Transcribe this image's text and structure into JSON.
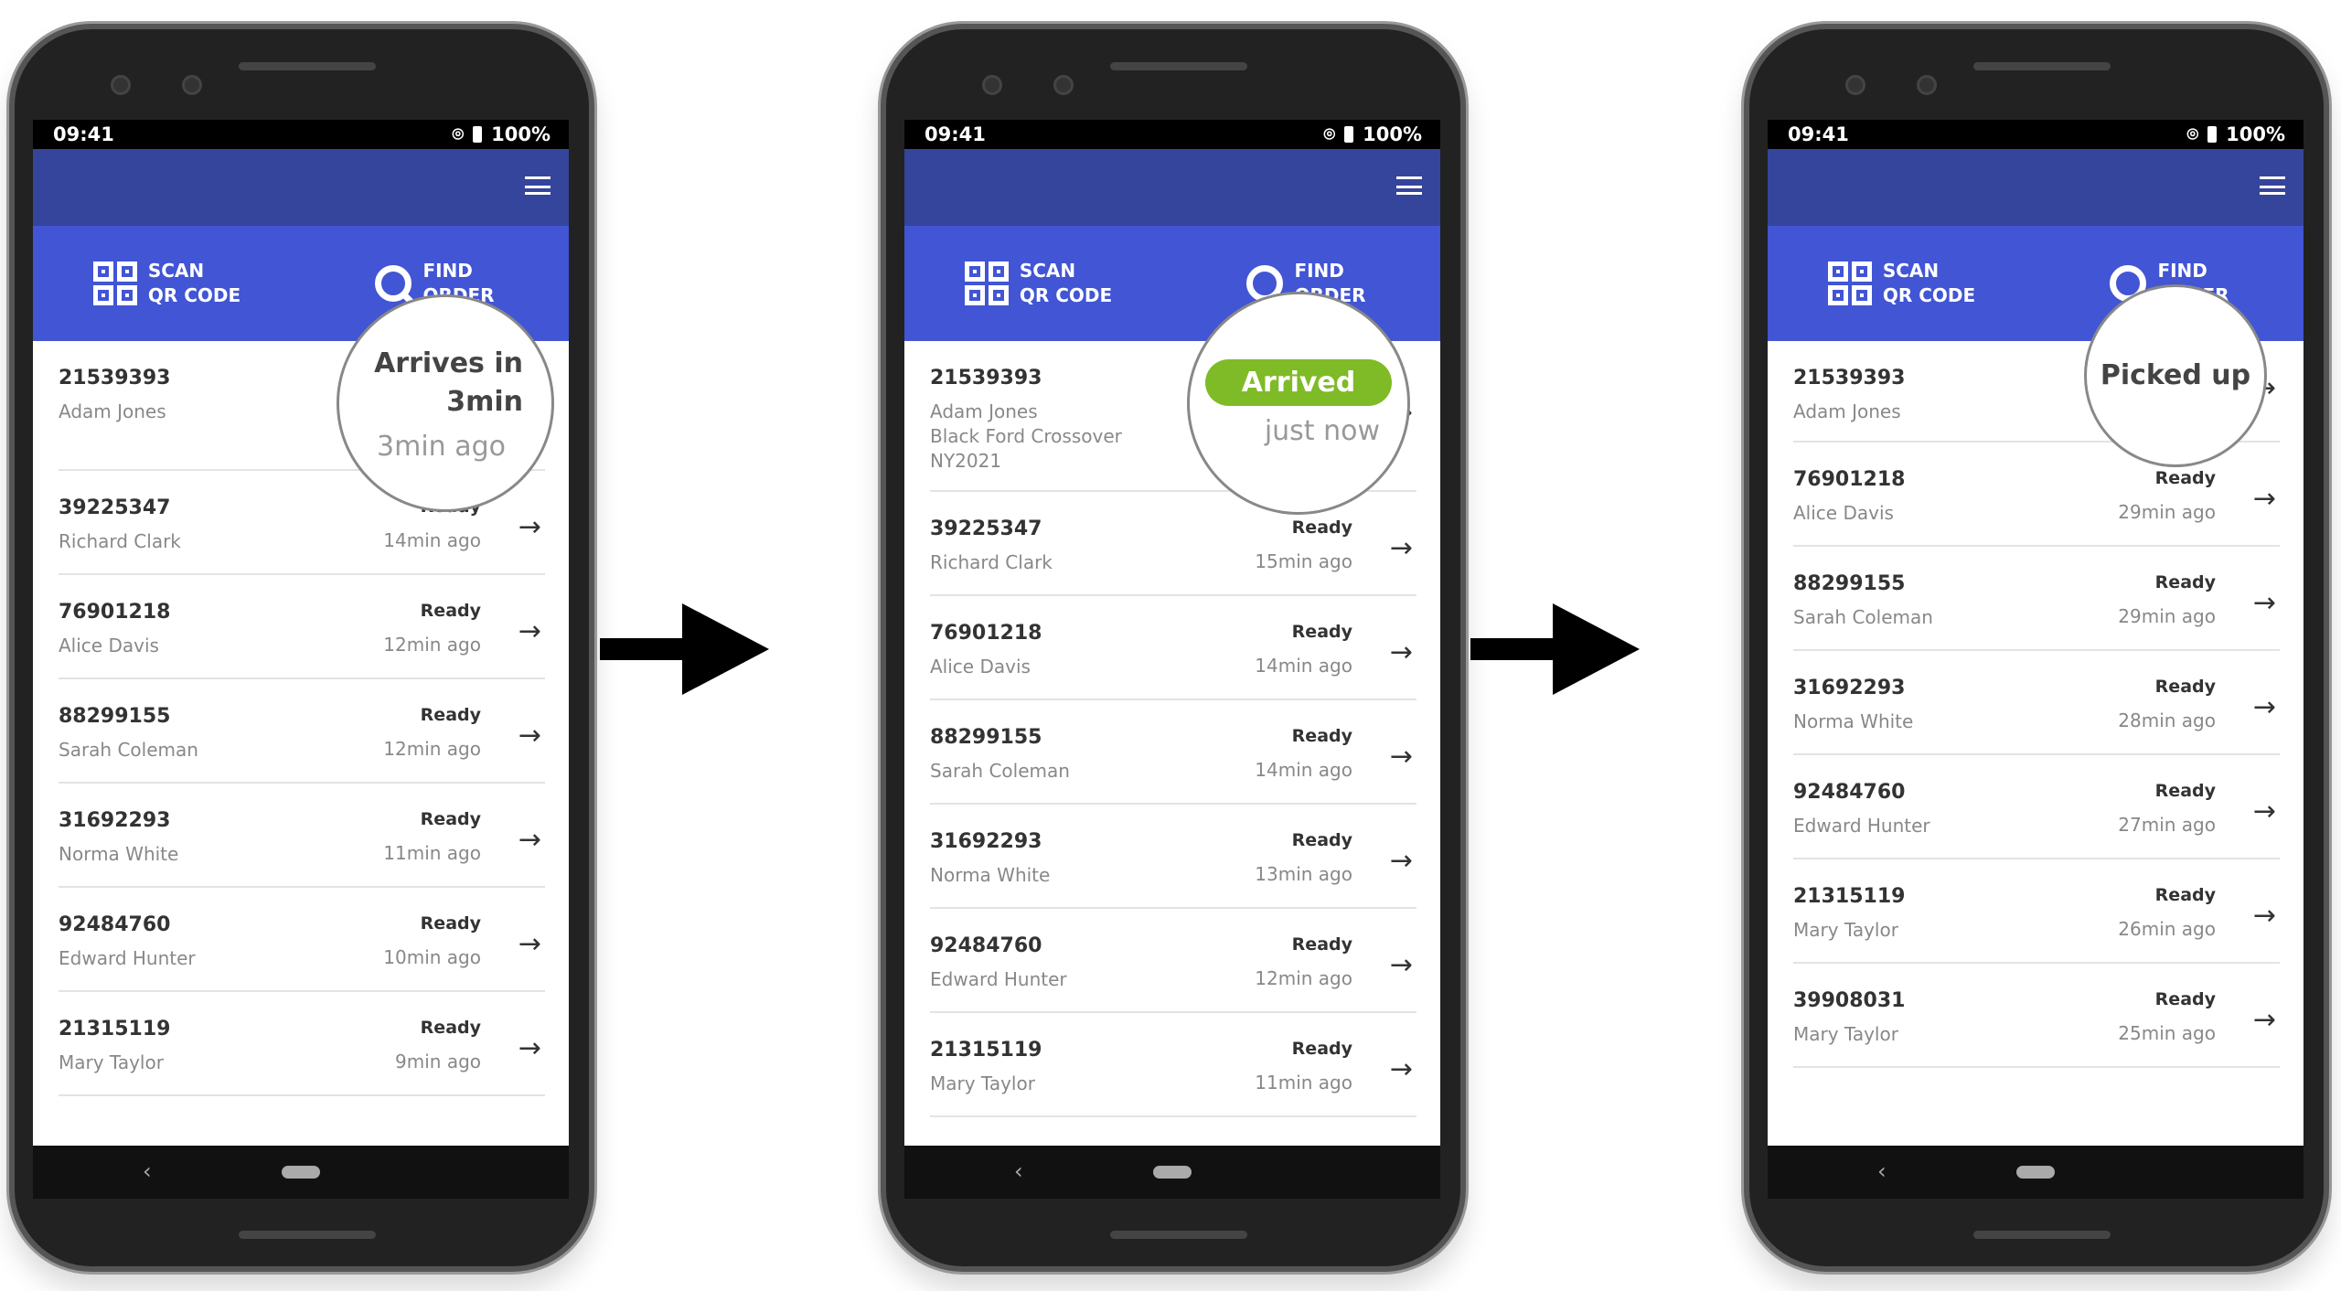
{
  "status": {
    "time": "09:41",
    "battery": "100%",
    "icons": [
      "location-icon",
      "battery-icon"
    ]
  },
  "actions": {
    "scan": "SCAN\nQR CODE",
    "scan1": "SCAN",
    "scan2": "QR CODE",
    "find1": "FIND",
    "find2": "ORDER"
  },
  "colors": {
    "header": "#35459c",
    "actions": "#4155d5",
    "arrived": "#7fbb26"
  },
  "phones": [
    {
      "magnifier": {
        "title": "Arrives in 3min",
        "sub": "3min ago"
      },
      "orders": [
        {
          "id": "21539393",
          "name": "Adam Jones",
          "status": "",
          "time": ""
        },
        {
          "id": "39225347",
          "name": "Richard Clark",
          "status": "Ready",
          "time": "14min ago"
        },
        {
          "id": "76901218",
          "name": "Alice Davis",
          "status": "Ready",
          "time": "12min ago"
        },
        {
          "id": "88299155",
          "name": "Sarah Coleman",
          "status": "Ready",
          "time": "12min ago"
        },
        {
          "id": "31692293",
          "name": "Norma White",
          "status": "Ready",
          "time": "11min ago"
        },
        {
          "id": "92484760",
          "name": "Edward Hunter",
          "status": "Ready",
          "time": "10min ago"
        },
        {
          "id": "21315119",
          "name": "Mary Taylor",
          "status": "Ready",
          "time": "9min ago"
        }
      ]
    },
    {
      "magnifier": {
        "badge": "Arrived",
        "sub": "just now"
      },
      "orders": [
        {
          "id": "21539393",
          "name": "Adam Jones",
          "vehicle": "Black Ford Crossover",
          "plate": "NY2021",
          "status": "",
          "time": ""
        },
        {
          "id": "39225347",
          "name": "Richard Clark",
          "status": "Ready",
          "time": "15min ago"
        },
        {
          "id": "76901218",
          "name": "Alice Davis",
          "status": "Ready",
          "time": "14min ago"
        },
        {
          "id": "88299155",
          "name": "Sarah Coleman",
          "status": "Ready",
          "time": "14min ago"
        },
        {
          "id": "31692293",
          "name": "Norma White",
          "status": "Ready",
          "time": "13min ago"
        },
        {
          "id": "92484760",
          "name": "Edward Hunter",
          "status": "Ready",
          "time": "12min ago"
        },
        {
          "id": "21315119",
          "name": "Mary Taylor",
          "status": "Ready",
          "time": "11min ago"
        }
      ]
    },
    {
      "magnifier": {
        "title": "Picked up"
      },
      "orders": [
        {
          "id": "21539393",
          "name": "Adam Jones",
          "status": "",
          "time": ""
        },
        {
          "id": "76901218",
          "name": "Alice Davis",
          "status": "Ready",
          "time": "29min ago"
        },
        {
          "id": "88299155",
          "name": "Sarah Coleman",
          "status": "Ready",
          "time": "29min ago"
        },
        {
          "id": "31692293",
          "name": "Norma White",
          "status": "Ready",
          "time": "28min ago"
        },
        {
          "id": "92484760",
          "name": "Edward Hunter",
          "status": "Ready",
          "time": "27min ago"
        },
        {
          "id": "21315119",
          "name": "Mary Taylor",
          "status": "Ready",
          "time": "26min ago"
        },
        {
          "id": "39908031",
          "name": "Mary Taylor",
          "status": "Ready",
          "time": "25min ago"
        }
      ]
    }
  ]
}
